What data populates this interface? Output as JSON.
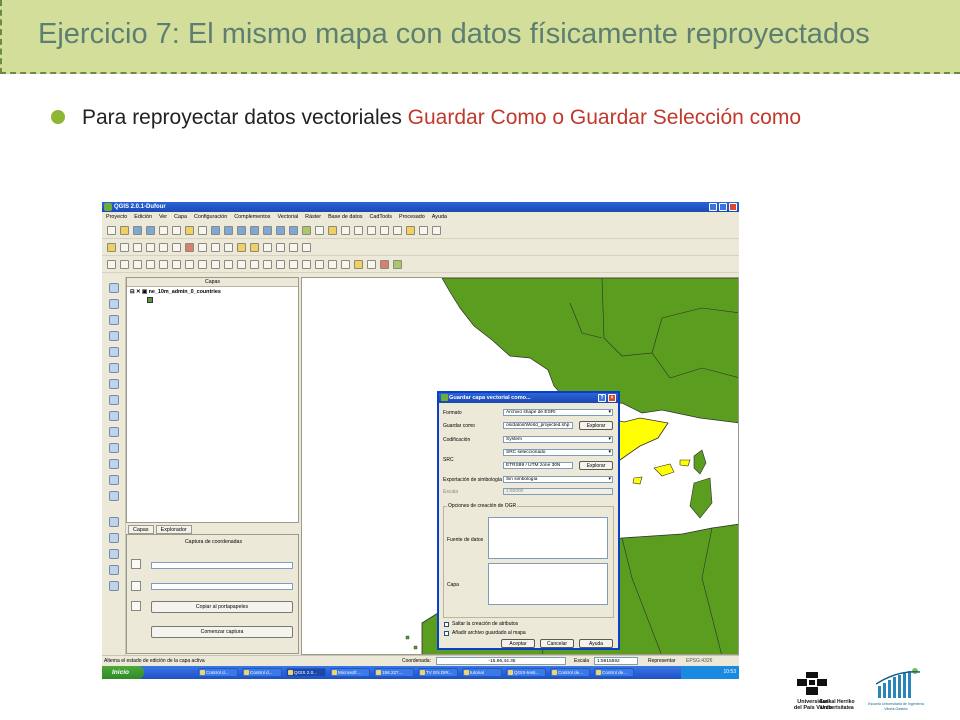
{
  "slide": {
    "title": "Ejercicio 7: El mismo mapa con datos físicamente reproyectados",
    "bullet": {
      "prefix": "Para reproyectar datos vectoriales ",
      "highlight": "Guardar Como o Guardar Selección como"
    }
  },
  "qgis": {
    "window_title": "QGIS 2.0.1-Dufour",
    "menu": [
      "Proyecto",
      "Edición",
      "Ver",
      "Capa",
      "Configuración",
      "Complementos",
      "Vectorial",
      "Ráster",
      "Base de datos",
      "CadTools",
      "Procesado",
      "Ayuda"
    ],
    "layers_panel": {
      "title": "Capas",
      "layer_name": "ne_10m_admin_0_countries"
    },
    "tabs": [
      "Capas",
      "Explorador"
    ],
    "coord_panel": {
      "title": "Captura de coordenadas",
      "copy_button": "Copiar al portapapeles",
      "start_button": "Comenzar captura"
    },
    "dialog": {
      "title": "Guardar capa vectorial como...",
      "format_label": "Formato",
      "format_value": "Archivo shape de ESRI",
      "save_as_label": "Guardar como",
      "save_as_value": "os/datos/World_projected.shp",
      "browse_label": "Explorar",
      "encoding_label": "Codificación",
      "encoding_value": "System",
      "src_label": "SRC",
      "src_mode_value": "SRC seleccionado",
      "src_value": "ETRS89 / UTM zone 30N",
      "src_browse_label": "Explorar",
      "symbology_label": "Exportación de simbología",
      "symbology_value": "Sin simbología",
      "scale_label": "Escala",
      "scale_value": "1:50000",
      "ogr_group": "Opciones de creación de OGR",
      "datasource_label": "Fuente de datos",
      "layer_label": "Capa",
      "skip_attrs": "Saltar la creación de atributos",
      "add_to_map": "Añadir archivo guardado al mapa",
      "accept": "Aceptar",
      "cancel": "Cancelar",
      "help": "Ayuda"
    },
    "status": {
      "message": "Alterna el estado de edición de la capa activa",
      "coord_label": "Coordenada:",
      "coord_value": "-15.96,44.35",
      "scale_label": "Escala",
      "scale_value": "1:5915592",
      "render_label": "Representar",
      "epsg": "EPSG:4326"
    },
    "taskbar": {
      "start": "Inicio",
      "tasks": [
        "Control d...",
        "Control d...",
        "QGIS 2.0...",
        "Microsoft ...",
        "158.227....",
        "TV EN DIR...",
        "tutorial",
        "QGIS-testi...",
        "Control de...",
        "Control de..."
      ],
      "clock": "10:53"
    }
  },
  "colors": {
    "title_band": "#d3de9a",
    "title_text": "#5d7e73",
    "bullet_dot": "#8db632",
    "highlight_text": "#c0392b",
    "land_green": "#5b9e1f",
    "spain_yellow": "#ffff00"
  },
  "logos": {
    "upv": [
      "Universidad",
      "del País Vasco",
      "Euskal Herriko",
      "Unibertsitatea"
    ],
    "eui": [
      "Escuela Universitaria de Ingeniería",
      "Vitoria-Gasteiz"
    ]
  }
}
